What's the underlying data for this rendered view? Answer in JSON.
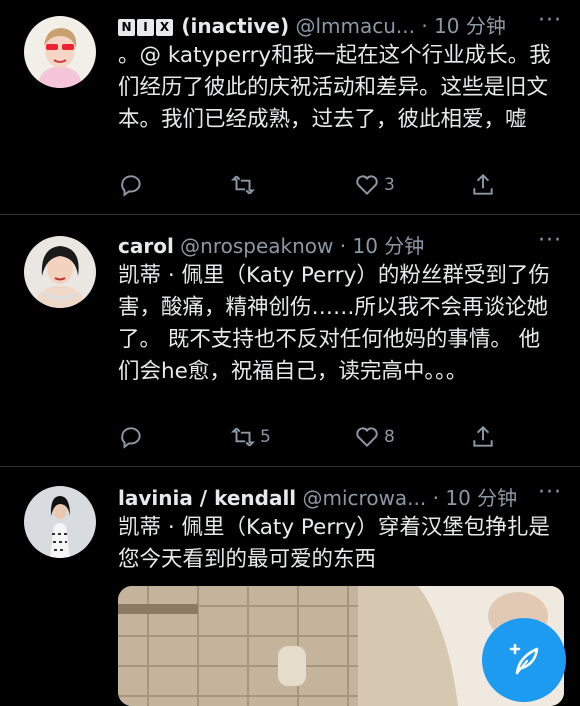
{
  "tweets": [
    {
      "badges": [
        "N",
        "I",
        "X"
      ],
      "name": "(inactive)",
      "handle": "@lmmacu...",
      "dot": "·",
      "time": "10 分钟",
      "text": "。@ katyperry和我一起在这个行业成长。我们经历了彼此的庆祝活动和差异。这些是旧文本。我们已经成熟，过去了，彼此相爱，嘘",
      "like_count": "3",
      "retweet_count": ""
    },
    {
      "name": "carol",
      "handle": "@nrospeaknow",
      "dot": "·",
      "time": "10 分钟",
      "text": "凯蒂 · 佩里（Katy Perry）的粉丝群受到了伤害，酸痛，精神创伤……所以我不会再谈论她了。 既不支持也不反对任何他妈的事情。 他们会he愈，祝福自己，读完高中。。。",
      "retweet_count": "5",
      "like_count": "8"
    },
    {
      "name": "lavinia / kendall",
      "handle": "@microwa...",
      "dot": "·",
      "time": "10 分钟",
      "text": "凯蒂 · 佩里（Katy Perry）穿着汉堡包挣扎是您今天看到的最可爱的东西"
    }
  ],
  "more_glyph": "···",
  "colors": {
    "background": "#000000",
    "text": "#e7e9ea",
    "muted": "#8b98a5",
    "accent": "#1d9bf0"
  },
  "icons": [
    "reply-icon",
    "retweet-icon",
    "like-icon",
    "share-icon",
    "compose-icon"
  ]
}
